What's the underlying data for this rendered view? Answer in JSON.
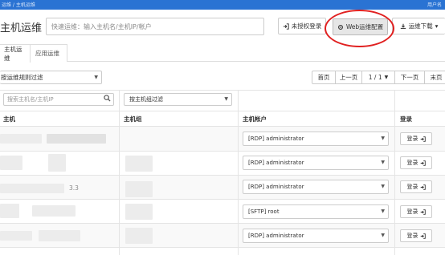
{
  "topbar": {
    "crumbs": "运维 / 主机运维",
    "user": "用户名"
  },
  "page": {
    "title": "主机运维"
  },
  "search": {
    "placeholder": "快速运维：输入主机名/主机IP/帐户"
  },
  "toolbar": {
    "unauthorized_label": "未授权登录",
    "web_config_label": "Web运维配置",
    "download_label": "运维下载"
  },
  "tabs": [
    {
      "label": "主机运维",
      "active": true
    },
    {
      "label": "应用运维",
      "active": false
    }
  ],
  "filter": {
    "rule_select_value": "按运维规则过滤"
  },
  "pager": {
    "first": "首页",
    "prev": "上一页",
    "page": "1 / 1",
    "next": "下一页",
    "last": "末页"
  },
  "table": {
    "host_search_placeholder": "搜索主机名/主机IP",
    "group_select_value": "按主机组过滤",
    "headers": {
      "host": "主机",
      "group": "主机组",
      "account": "主机帐户",
      "login": "登录"
    },
    "rows": [
      {
        "host": "",
        "group": "",
        "account": "[RDP] administrator",
        "login": "登录"
      },
      {
        "host": "",
        "group": "",
        "account": "[RDP] administrator",
        "login": "登录"
      },
      {
        "host": "3.3",
        "group": "",
        "account": "[RDP] administrator",
        "login": "登录"
      },
      {
        "host": "",
        "group": "",
        "account": "[SFTP] root",
        "login": "登录"
      },
      {
        "host": "",
        "group": "",
        "account": "[RDP] administrator",
        "login": "登录"
      }
    ]
  },
  "icons": {
    "unauthorized": "sign-in-icon",
    "web_config": "gear-icon",
    "download": "download-icon",
    "search": "search-icon",
    "login": "sign-in-icon",
    "dropdown": "chevron-down-icon"
  },
  "colors": {
    "topbar": "#2a73d3",
    "highlight_ring": "#e02020",
    "web_button_bg": "#e6e6e6"
  }
}
